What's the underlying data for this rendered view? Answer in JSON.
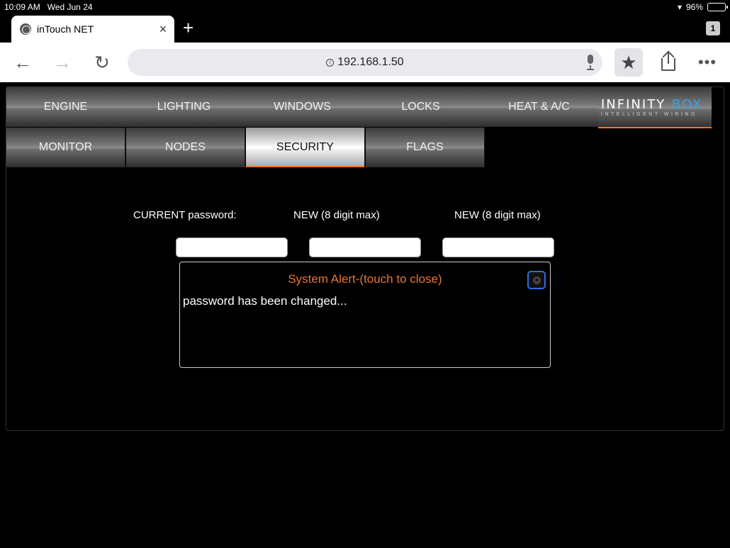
{
  "status_bar": {
    "time": "10:09 AM",
    "date": "Wed Jun 24",
    "battery": "96%",
    "battery_level": 0.96
  },
  "browser": {
    "tab_title": "inTouch NET",
    "tab_close": "×",
    "new_tab": "+",
    "tab_count": "1",
    "url": "192.168.1.50",
    "icons": {
      "back": "arrow-left-icon",
      "forward": "arrow-right-icon",
      "reload": "reload-icon",
      "bookmark": "star-icon",
      "share": "share-icon",
      "more": "more-icon"
    }
  },
  "app": {
    "nav_row1": [
      {
        "label": "ENGINE"
      },
      {
        "label": "LIGHTING"
      },
      {
        "label": "WINDOWS"
      },
      {
        "label": "LOCKS"
      },
      {
        "label": "HEAT & A/C"
      }
    ],
    "nav_row2": [
      {
        "label": "MONITOR"
      },
      {
        "label": "NODES"
      },
      {
        "label": "SECURITY",
        "active": true
      },
      {
        "label": "FLAGS"
      }
    ],
    "logo": {
      "word1": "INFINITY",
      "word2": "BOX",
      "tagline": "INTELLIGENT WIRING"
    },
    "form": {
      "current_label": "CURRENT password:",
      "new_label_1": "NEW (8 digit max)",
      "new_label_2": "NEW (8 digit max)",
      "current_value": "",
      "new_value_1": "",
      "new_value_2": ""
    },
    "alert": {
      "title": "System Alert-(touch to close)",
      "message": "password has been changed...",
      "close_symbol": "×"
    },
    "colors": {
      "accent": "#e8742c",
      "logo_blue": "#3aa3e0",
      "close_border": "#2f6fd6"
    }
  }
}
